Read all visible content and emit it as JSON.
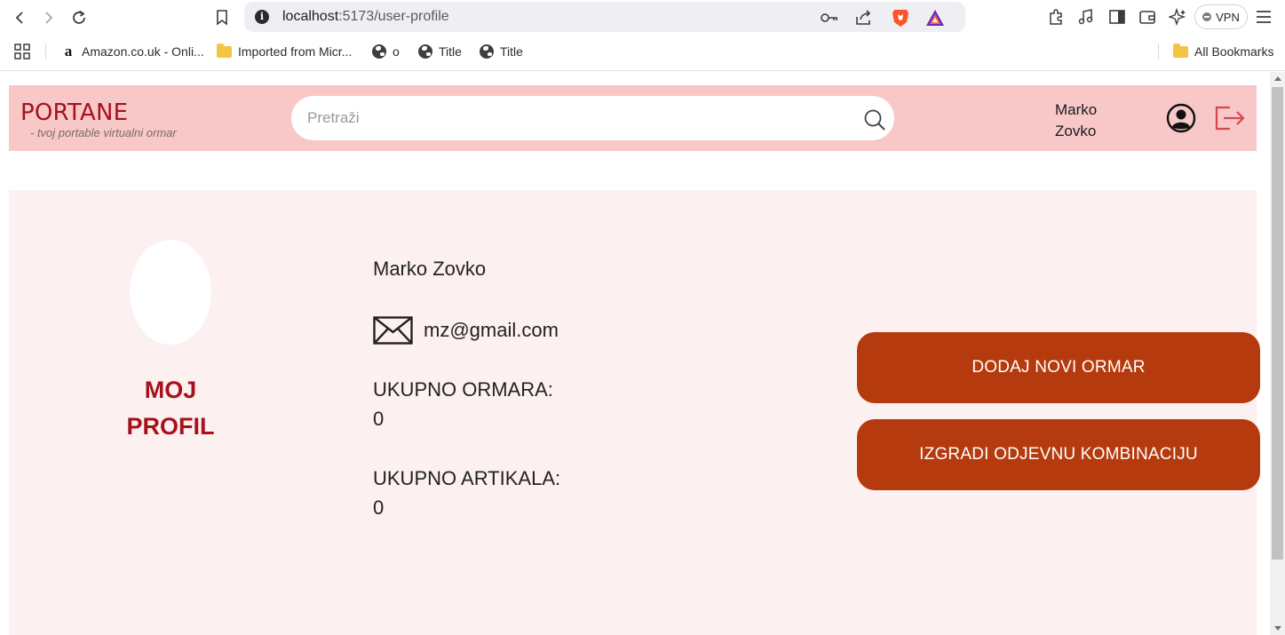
{
  "browser": {
    "url_host": "localhost",
    "url_path": ":5173/user-profile",
    "vpn_label": "VPN",
    "bookmarks": [
      {
        "icon": "amazon-icon",
        "label": "Amazon.co.uk - Onli..."
      },
      {
        "icon": "folder-icon",
        "label": "Imported from Micr..."
      },
      {
        "icon": "globe-icon",
        "label": "o"
      },
      {
        "icon": "globe-icon",
        "label": "Title"
      },
      {
        "icon": "globe-icon",
        "label": "Title"
      }
    ],
    "all_bookmarks_label": "All Bookmarks"
  },
  "header": {
    "brand": "PORTANE",
    "tagline": "- tvoj portable virtualni ormar",
    "search_placeholder": "Pretraži",
    "user_first": "Marko",
    "user_last": "Zovko"
  },
  "profile": {
    "section_title_line1": "MOJ",
    "section_title_line2": "PROFIL",
    "full_name": "Marko Zovko",
    "email": "mz@gmail.com",
    "total_wardrobes_label": "UKUPNO ORMARA:",
    "total_wardrobes_value": "0",
    "total_items_label": "UKUPNO ARTIKALA:",
    "total_items_value": "0"
  },
  "actions": {
    "add_wardrobe": "DODAJ NOVI ORMAR",
    "build_outfit": "IZGRADI ODJEVNU KOMBINACIJU"
  },
  "colors": {
    "header_bg": "#f8c8c8",
    "card_bg": "#fdf0f0",
    "brand": "#a8111c",
    "button": "#b53a0d"
  }
}
